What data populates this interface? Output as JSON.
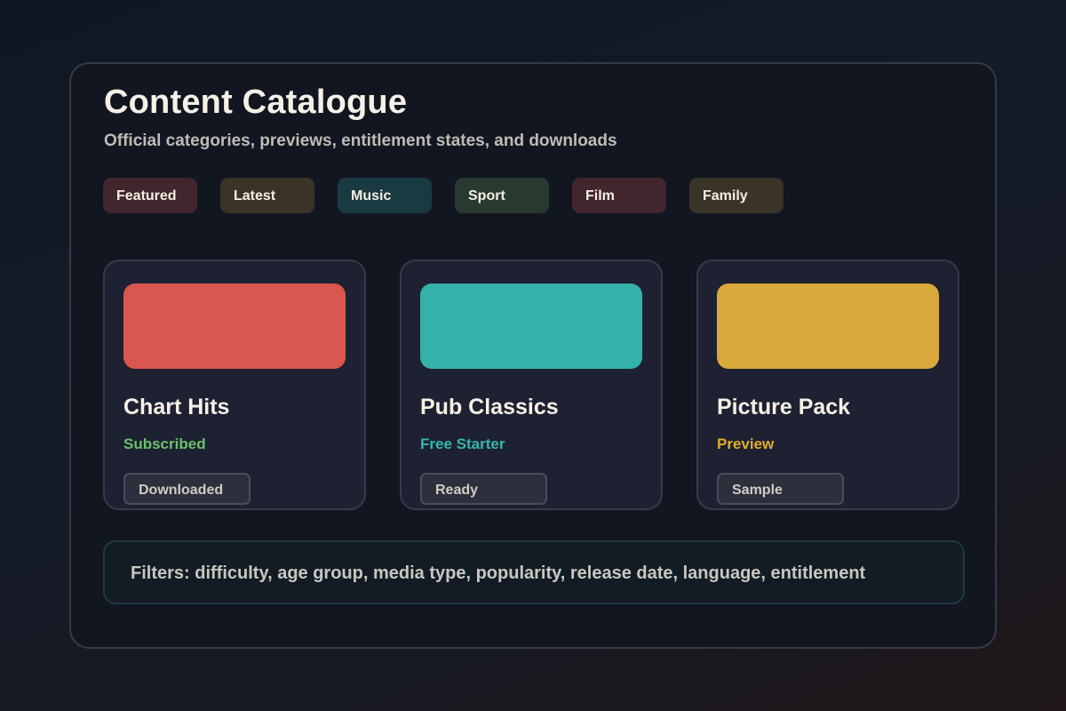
{
  "header": {
    "title": "Content Catalogue",
    "subtitle": "Official categories, previews, entitlement states, and downloads"
  },
  "tabs": [
    {
      "label": "Featured",
      "color": "#41262d"
    },
    {
      "label": "Latest",
      "color": "#3a3328"
    },
    {
      "label": "Music",
      "color": "#1a3a42"
    },
    {
      "label": "Sport",
      "color": "#283a30"
    },
    {
      "label": "Film",
      "color": "#41262d"
    },
    {
      "label": "Family",
      "color": "#3a3328"
    }
  ],
  "cards": [
    {
      "name": "Chart Hits",
      "status": "Subscribed",
      "status_color": "#6cc06a",
      "badge": "Downloaded",
      "thumb_color": "#d9574e"
    },
    {
      "name": "Pub Classics",
      "status": "Free Starter",
      "status_color": "#35b7ad",
      "badge": "Ready",
      "thumb_color": "#34b2aa"
    },
    {
      "name": "Picture Pack",
      "status": "Preview",
      "status_color": "#e0ad2e",
      "badge": "Sample",
      "thumb_color": "#d8a93a"
    }
  ],
  "filters": {
    "text": "Filters: difficulty, age group, media type, popularity, release date, language, entitlement"
  }
}
